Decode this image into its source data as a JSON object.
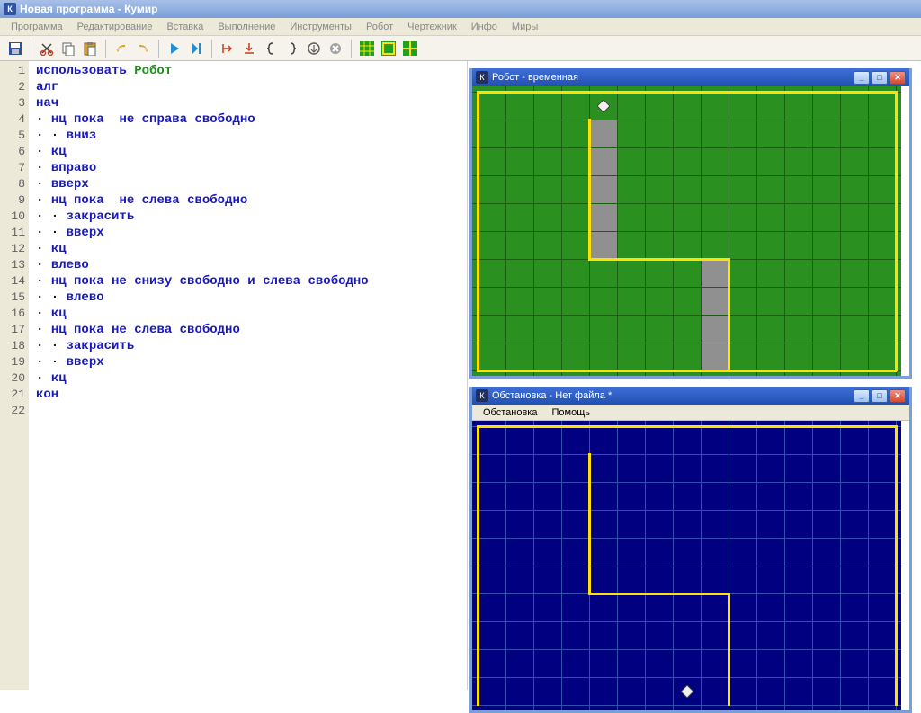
{
  "title": "Новая программа - Кумир",
  "app_icon": "К",
  "menubar": [
    "Программа",
    "Редактирование",
    "Вставка",
    "Выполнение",
    "Инструменты",
    "Робот",
    "Чертежник",
    "Инфо",
    "Миры"
  ],
  "code_lines": [
    {
      "n": 1,
      "tokens": [
        {
          "t": "использовать ",
          "c": "kw"
        },
        {
          "t": "Робот",
          "c": "gr"
        }
      ]
    },
    {
      "n": 2,
      "tokens": [
        {
          "t": "алг",
          "c": "kw"
        }
      ]
    },
    {
      "n": 3,
      "tokens": [
        {
          "t": "нач",
          "c": "kw"
        }
      ]
    },
    {
      "n": 4,
      "tokens": [
        {
          "t": "· ",
          "c": "pl"
        },
        {
          "t": "нц пока  ",
          "c": "kw"
        },
        {
          "t": "не ",
          "c": "kw"
        },
        {
          "t": "справа свободно",
          "c": "kw"
        }
      ]
    },
    {
      "n": 5,
      "tokens": [
        {
          "t": "· · ",
          "c": "pl"
        },
        {
          "t": "вниз",
          "c": "kw"
        }
      ]
    },
    {
      "n": 6,
      "tokens": [
        {
          "t": "· ",
          "c": "pl"
        },
        {
          "t": "кц",
          "c": "kw"
        }
      ]
    },
    {
      "n": 7,
      "tokens": [
        {
          "t": "· ",
          "c": "pl"
        },
        {
          "t": "вправо",
          "c": "kw"
        }
      ]
    },
    {
      "n": 8,
      "tokens": [
        {
          "t": "· ",
          "c": "pl"
        },
        {
          "t": "вверх",
          "c": "kw"
        }
      ]
    },
    {
      "n": 9,
      "tokens": [
        {
          "t": "· ",
          "c": "pl"
        },
        {
          "t": "нц пока  ",
          "c": "kw"
        },
        {
          "t": "не ",
          "c": "kw"
        },
        {
          "t": "слева свободно",
          "c": "kw"
        }
      ]
    },
    {
      "n": 10,
      "tokens": [
        {
          "t": "· · ",
          "c": "pl"
        },
        {
          "t": "закрасить",
          "c": "kw"
        }
      ]
    },
    {
      "n": 11,
      "tokens": [
        {
          "t": "· · ",
          "c": "pl"
        },
        {
          "t": "вверх",
          "c": "kw"
        }
      ]
    },
    {
      "n": 12,
      "tokens": [
        {
          "t": "· ",
          "c": "pl"
        },
        {
          "t": "кц",
          "c": "kw"
        }
      ]
    },
    {
      "n": 13,
      "tokens": [
        {
          "t": "· ",
          "c": "pl"
        },
        {
          "t": "влево",
          "c": "kw"
        }
      ]
    },
    {
      "n": 14,
      "tokens": [
        {
          "t": "· ",
          "c": "pl"
        },
        {
          "t": "нц пока не ",
          "c": "kw"
        },
        {
          "t": "снизу свободно",
          "c": "kw"
        },
        {
          "t": " и ",
          "c": "kw"
        },
        {
          "t": "слева свободно",
          "c": "kw"
        }
      ]
    },
    {
      "n": 15,
      "tokens": [
        {
          "t": "· · ",
          "c": "pl"
        },
        {
          "t": "влево",
          "c": "kw"
        }
      ]
    },
    {
      "n": 16,
      "tokens": [
        {
          "t": "· ",
          "c": "pl"
        },
        {
          "t": "кц",
          "c": "kw"
        }
      ]
    },
    {
      "n": 17,
      "tokens": [
        {
          "t": "· ",
          "c": "pl"
        },
        {
          "t": "нц пока не ",
          "c": "kw"
        },
        {
          "t": "слева свободно",
          "c": "kw"
        }
      ]
    },
    {
      "n": 18,
      "tokens": [
        {
          "t": "· · ",
          "c": "pl"
        },
        {
          "t": "закрасить",
          "c": "kw"
        }
      ]
    },
    {
      "n": 19,
      "tokens": [
        {
          "t": "· · ",
          "c": "pl"
        },
        {
          "t": "вверх",
          "c": "kw"
        }
      ]
    },
    {
      "n": 20,
      "tokens": [
        {
          "t": "· ",
          "c": "pl"
        },
        {
          "t": "кц",
          "c": "kw"
        }
      ]
    },
    {
      "n": 21,
      "tokens": [
        {
          "t": "кон",
          "c": "kw"
        }
      ]
    },
    {
      "n": 22,
      "tokens": [
        {
          "t": "",
          "c": "pl"
        }
      ]
    }
  ],
  "robot_window": {
    "title": "Робот - временная",
    "grid": {
      "cols": 15,
      "rows": 10,
      "cell": 31,
      "ox": 6,
      "oy": 6
    },
    "painted": [
      [
        4,
        1
      ],
      [
        4,
        2
      ],
      [
        4,
        3
      ],
      [
        4,
        4
      ],
      [
        4,
        5
      ],
      [
        8,
        6
      ],
      [
        8,
        7
      ],
      [
        8,
        8
      ],
      [
        8,
        9
      ]
    ],
    "walls_h": [
      [
        0,
        0,
        15
      ],
      [
        0,
        10,
        15
      ],
      [
        4,
        6,
        5
      ],
      [
        8,
        6,
        1
      ]
    ],
    "walls_v": [
      [
        0,
        0,
        10
      ],
      [
        15,
        0,
        10
      ],
      [
        4,
        1,
        5
      ],
      [
        9,
        6,
        4
      ]
    ],
    "robot": [
      4,
      0
    ]
  },
  "env_window": {
    "title": "Обстановка - Нет файла *",
    "menubar": [
      "Обстановка",
      "Помощь"
    ],
    "grid": {
      "cols": 15,
      "rows": 10,
      "cell": 31,
      "ox": 6,
      "oy": 6
    },
    "walls_h": [
      [
        0,
        0,
        15
      ],
      [
        4,
        6,
        5
      ]
    ],
    "walls_v": [
      [
        0,
        0,
        10
      ],
      [
        15,
        0,
        10
      ],
      [
        4,
        1,
        5
      ],
      [
        9,
        6,
        4
      ]
    ],
    "robot": [
      7,
      9
    ]
  }
}
